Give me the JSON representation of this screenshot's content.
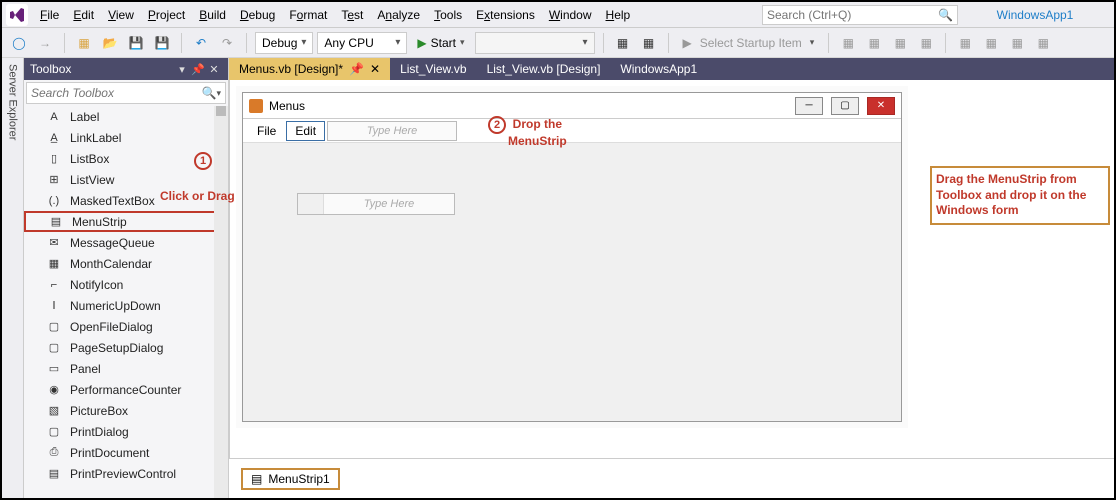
{
  "menubar": {
    "items": [
      "File",
      "Edit",
      "View",
      "Project",
      "Build",
      "Debug",
      "Format",
      "Test",
      "Analyze",
      "Tools",
      "Extensions",
      "Window",
      "Help"
    ],
    "search_placeholder": "Search (Ctrl+Q)",
    "app_title": "WindowsApp1"
  },
  "toolbar": {
    "config": "Debug",
    "platform": "Any CPU",
    "start": "Start",
    "startup": "Select Startup Item"
  },
  "server_explorer": "Server Explorer",
  "toolbox": {
    "title": "Toolbox",
    "search_placeholder": "Search Toolbox",
    "items": [
      {
        "icon": "A",
        "label": "Label"
      },
      {
        "icon": "A̲",
        "label": "LinkLabel"
      },
      {
        "icon": "▯",
        "label": "ListBox"
      },
      {
        "icon": "⊞",
        "label": "ListView"
      },
      {
        "icon": "(.)",
        "label": "MaskedTextBox"
      },
      {
        "icon": "▤",
        "label": "MenuStrip",
        "hl": true
      },
      {
        "icon": "✉",
        "label": "MessageQueue"
      },
      {
        "icon": "▦",
        "label": "MonthCalendar"
      },
      {
        "icon": "⌐",
        "label": "NotifyIcon"
      },
      {
        "icon": "Ⅰ",
        "label": "NumericUpDown"
      },
      {
        "icon": "▢",
        "label": "OpenFileDialog"
      },
      {
        "icon": "▢",
        "label": "PageSetupDialog"
      },
      {
        "icon": "▭",
        "label": "Panel"
      },
      {
        "icon": "◉",
        "label": "PerformanceCounter"
      },
      {
        "icon": "▧",
        "label": "PictureBox"
      },
      {
        "icon": "▢",
        "label": "PrintDialog"
      },
      {
        "icon": "⎙",
        "label": "PrintDocument"
      },
      {
        "icon": "▤",
        "label": "PrintPreviewControl"
      }
    ]
  },
  "tabs": [
    {
      "label": "Menus.vb [Design]*",
      "active": true,
      "pin": true
    },
    {
      "label": "List_View.vb"
    },
    {
      "label": "List_View.vb [Design]"
    },
    {
      "label": "WindowsApp1"
    }
  ],
  "form": {
    "title": "Menus",
    "menu_items": {
      "file": "File",
      "edit": "Edit"
    },
    "type_here": "Type Here"
  },
  "callouts": {
    "num1": "1",
    "num2": "2",
    "click_or_drag": "Click or Drag",
    "drop1": "Drop the",
    "drop2": "MenuStrip",
    "instruction": "Drag the MenuStrip from Toolbox and drop it on the Windows form"
  },
  "tray": {
    "item": "MenuStrip1"
  }
}
